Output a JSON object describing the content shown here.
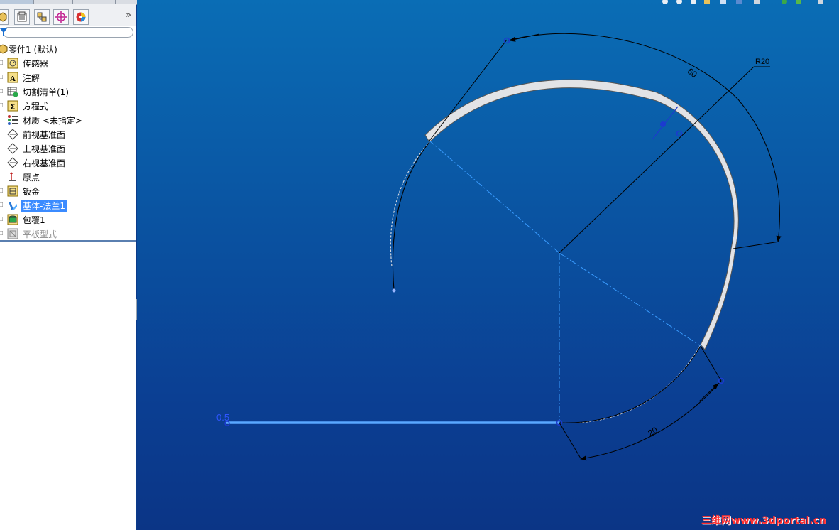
{
  "feature_tree": {
    "root_label": "零件1 (默认)",
    "items": [
      {
        "label": "传感器",
        "icon": "sensor-icon"
      },
      {
        "label": "注解",
        "icon": "annotation-icon"
      },
      {
        "label": "切割清单(1)",
        "icon": "cut-list-icon"
      },
      {
        "label": "方程式",
        "icon": "equation-icon"
      },
      {
        "label": "材质 <未指定>",
        "icon": "material-icon"
      },
      {
        "label": "前视基准面",
        "icon": "plane-icon"
      },
      {
        "label": "上视基准面",
        "icon": "plane-icon"
      },
      {
        "label": "右视基准面",
        "icon": "plane-icon"
      },
      {
        "label": "原点",
        "icon": "origin-icon"
      },
      {
        "label": "钣金",
        "icon": "sheet-metal-icon"
      },
      {
        "label": "基体-法兰1",
        "icon": "base-flange-icon",
        "selected": true
      },
      {
        "label": "包覆1",
        "icon": "wrap-icon"
      },
      {
        "label": "平板型式",
        "icon": "flat-pattern-icon",
        "suppressed": true
      }
    ]
  },
  "panel_tabs": [
    "feature-manager-tab",
    "property-manager-tab",
    "configuration-manager-tab",
    "dimxpert-tab",
    "display-manager-tab"
  ],
  "dimensions": {
    "angle_top": "60",
    "radius": "R20",
    "angle_bottom": "20",
    "thickness": "0.5"
  },
  "watermark": "三维网www.3dportal.cn",
  "colors": {
    "viewport_top": "#0a6db5",
    "viewport_bottom": "#0b3586",
    "selection_blue": "#3b8bff",
    "dimension_black": "#000000",
    "watermark_red": "#ff2e2e"
  }
}
